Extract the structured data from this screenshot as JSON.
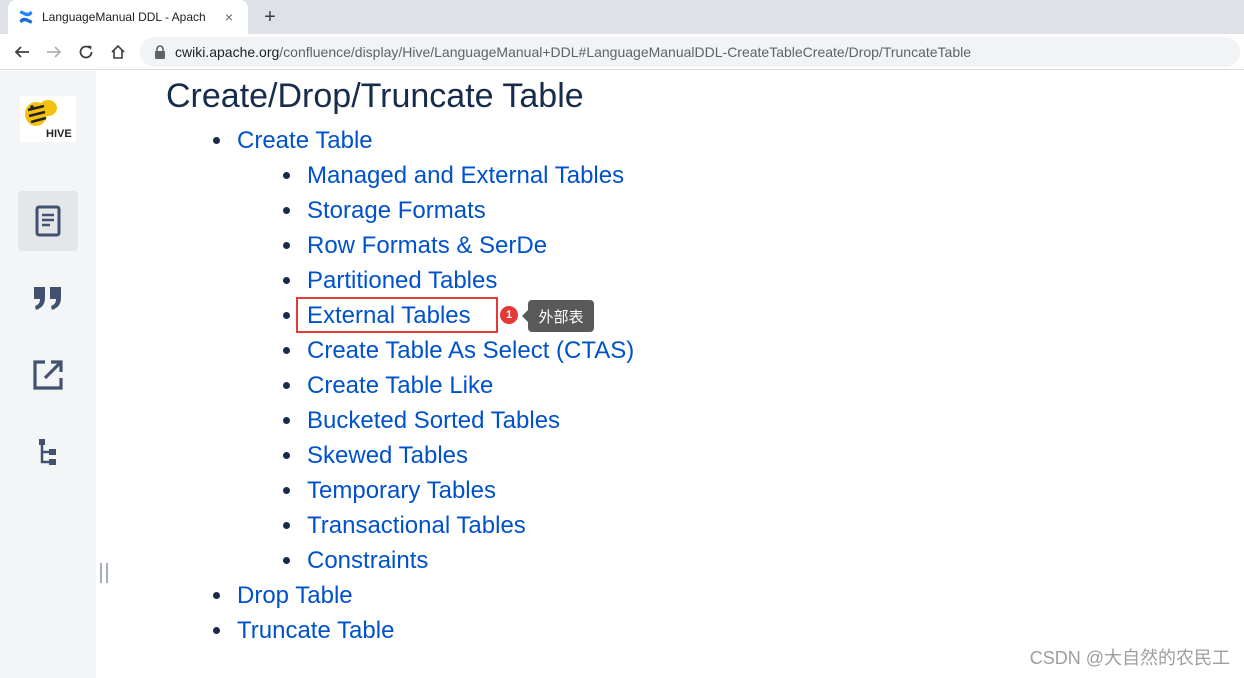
{
  "browser": {
    "tab_title": "LanguageManual DDL - Apach",
    "tab_close": "×",
    "new_tab": "+",
    "url_host": "cwiki.apache.org",
    "url_path": "/confluence/display/Hive/LanguageManual+DDL#LanguageManualDDL-CreateTableCreate/Drop/TruncateTable"
  },
  "sidebar": {
    "logo_text": "HIVE",
    "buttons": [
      "pages-icon",
      "quote-icon",
      "share-icon",
      "hierarchy-icon"
    ]
  },
  "content": {
    "heading": "Create/Drop/Truncate Table",
    "toc": [
      {
        "label": "Create Table",
        "level": 1
      },
      {
        "label": "Managed and External Tables",
        "level": 2
      },
      {
        "label": "Storage Formats",
        "level": 2
      },
      {
        "label": "Row Formats & SerDe",
        "level": 2
      },
      {
        "label": "Partitioned Tables",
        "level": 2
      },
      {
        "label": "External Tables",
        "level": 2
      },
      {
        "label": "Create Table As Select (CTAS)",
        "level": 2
      },
      {
        "label": "Create Table Like",
        "level": 2
      },
      {
        "label": "Bucketed Sorted Tables",
        "level": 2
      },
      {
        "label": "Skewed Tables",
        "level": 2
      },
      {
        "label": "Temporary Tables",
        "level": 2
      },
      {
        "label": "Transactional Tables",
        "level": 2
      },
      {
        "label": "Constraints",
        "level": 2
      },
      {
        "label": "Drop Table",
        "level": 1
      },
      {
        "label": "Truncate Table",
        "level": 1
      }
    ]
  },
  "annotation": {
    "marker": "1",
    "tooltip": "外部表"
  },
  "watermark": "CSDN @大自然的农民工",
  "colors": {
    "link": "#0052cc",
    "heading": "#172b4d",
    "sidebar_bg": "#f4f5f7",
    "highlight": "#e53935"
  }
}
